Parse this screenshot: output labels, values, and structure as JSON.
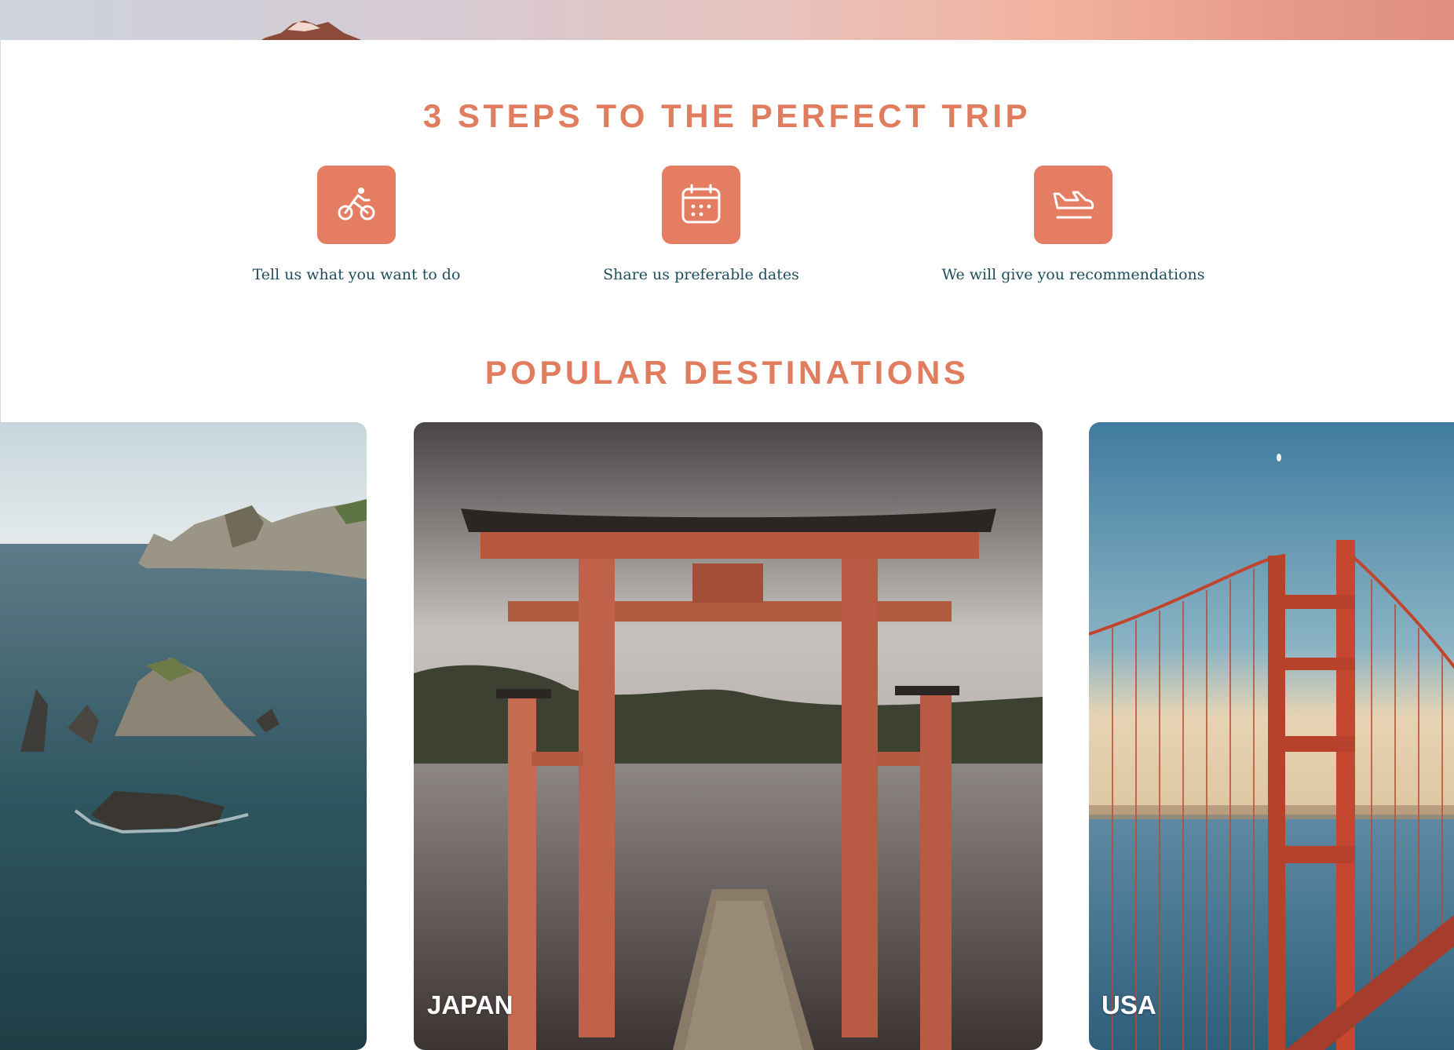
{
  "steps_section": {
    "title": "3 STEPS TO THE PERFECT TRIP",
    "steps": [
      {
        "icon": "bicycle-icon",
        "label": "Tell us what you want to do"
      },
      {
        "icon": "calendar-icon",
        "label": "Share us preferable dates"
      },
      {
        "icon": "plane-landing-icon",
        "label": "We will give you recommendations"
      }
    ]
  },
  "destinations_section": {
    "title": "POPULAR DESTINATIONS",
    "cards": [
      {
        "label": "",
        "image": "coastline-rocks-photo"
      },
      {
        "label": "JAPAN",
        "image": "torii-gate-photo"
      },
      {
        "label": "USA",
        "image": "golden-gate-bridge-photo"
      }
    ]
  },
  "colors": {
    "accent": "#e07d5f",
    "icon_bg": "#e47d62",
    "step_text": "#1e4e5c"
  }
}
